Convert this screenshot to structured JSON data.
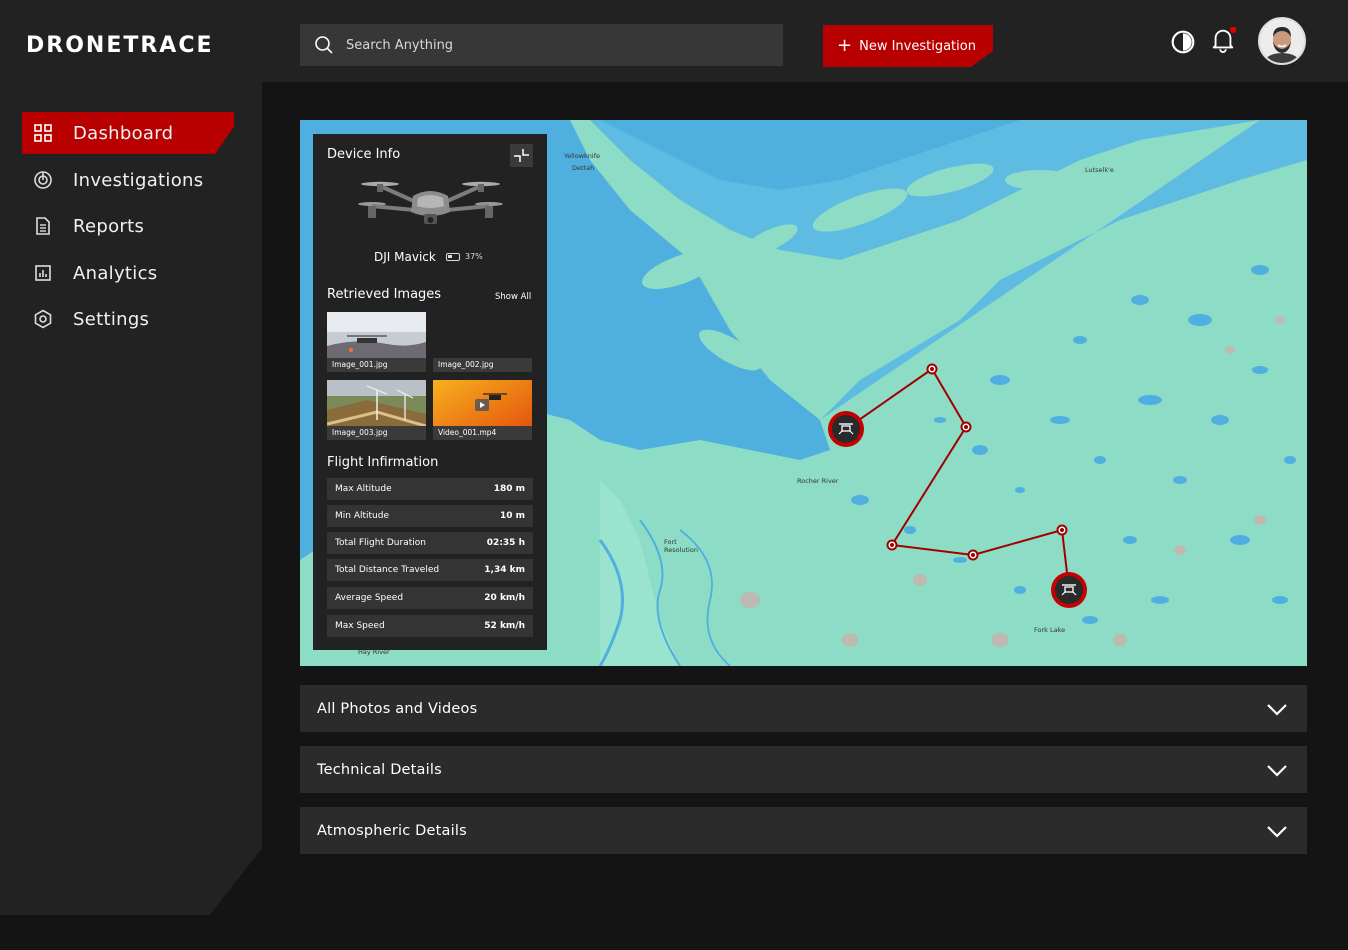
{
  "app": {
    "logo": "DRONETRACE"
  },
  "header": {
    "search_placeholder": "Search Anything",
    "new_button_label": "New Investigation",
    "icons": [
      "theme-toggle-icon",
      "bell-icon"
    ],
    "notification_dot_color": "#e00000"
  },
  "sidebar": {
    "items": [
      {
        "label": "Dashboard",
        "icon": "dashboard-icon",
        "active": true
      },
      {
        "label": "Investigations",
        "icon": "radar-icon",
        "active": false
      },
      {
        "label": "Reports",
        "icon": "document-icon",
        "active": false
      },
      {
        "label": "Analytics",
        "icon": "chart-icon",
        "active": false
      },
      {
        "label": "Settings",
        "icon": "gear-icon",
        "active": false
      }
    ]
  },
  "device": {
    "title": "Device Info",
    "name": "DJI Mavick",
    "battery": "37%",
    "battery_level": 0.37
  },
  "retrieved": {
    "title": "Retrieved Images",
    "show_all": "Show All",
    "items": [
      {
        "name": "Image_001.jpg"
      },
      {
        "name": "Image_002.jpg"
      },
      {
        "name": "Image_003.jpg"
      },
      {
        "name": "Video_001.mp4"
      }
    ]
  },
  "flight": {
    "title": "Flight Infirmation",
    "rows": [
      {
        "label": "Max Altitude",
        "value": "180 m"
      },
      {
        "label": "Min Altitude",
        "value": "10 m"
      },
      {
        "label": "Total Flight Duration",
        "value": "02:35 h"
      },
      {
        "label": "Total Distance Traveled",
        "value": "1,34 km"
      },
      {
        "label": "Average Speed",
        "value": "20 km/h"
      },
      {
        "label": "Max Speed",
        "value": "52 km/h"
      }
    ]
  },
  "map": {
    "labels": [
      "Yellowknife",
      "Dettah",
      "Lutselk'e",
      "Rocher River",
      "Fort Resolution",
      "Fork Lake",
      "Hay River"
    ],
    "route_color": "#a00000"
  },
  "accordions": [
    {
      "label": "All Photos and Videos"
    },
    {
      "label": "Technical Details"
    },
    {
      "label": "Atmospheric Details"
    }
  ],
  "colors": {
    "accent": "#b80000",
    "panel": "#222223",
    "background": "#141414"
  }
}
